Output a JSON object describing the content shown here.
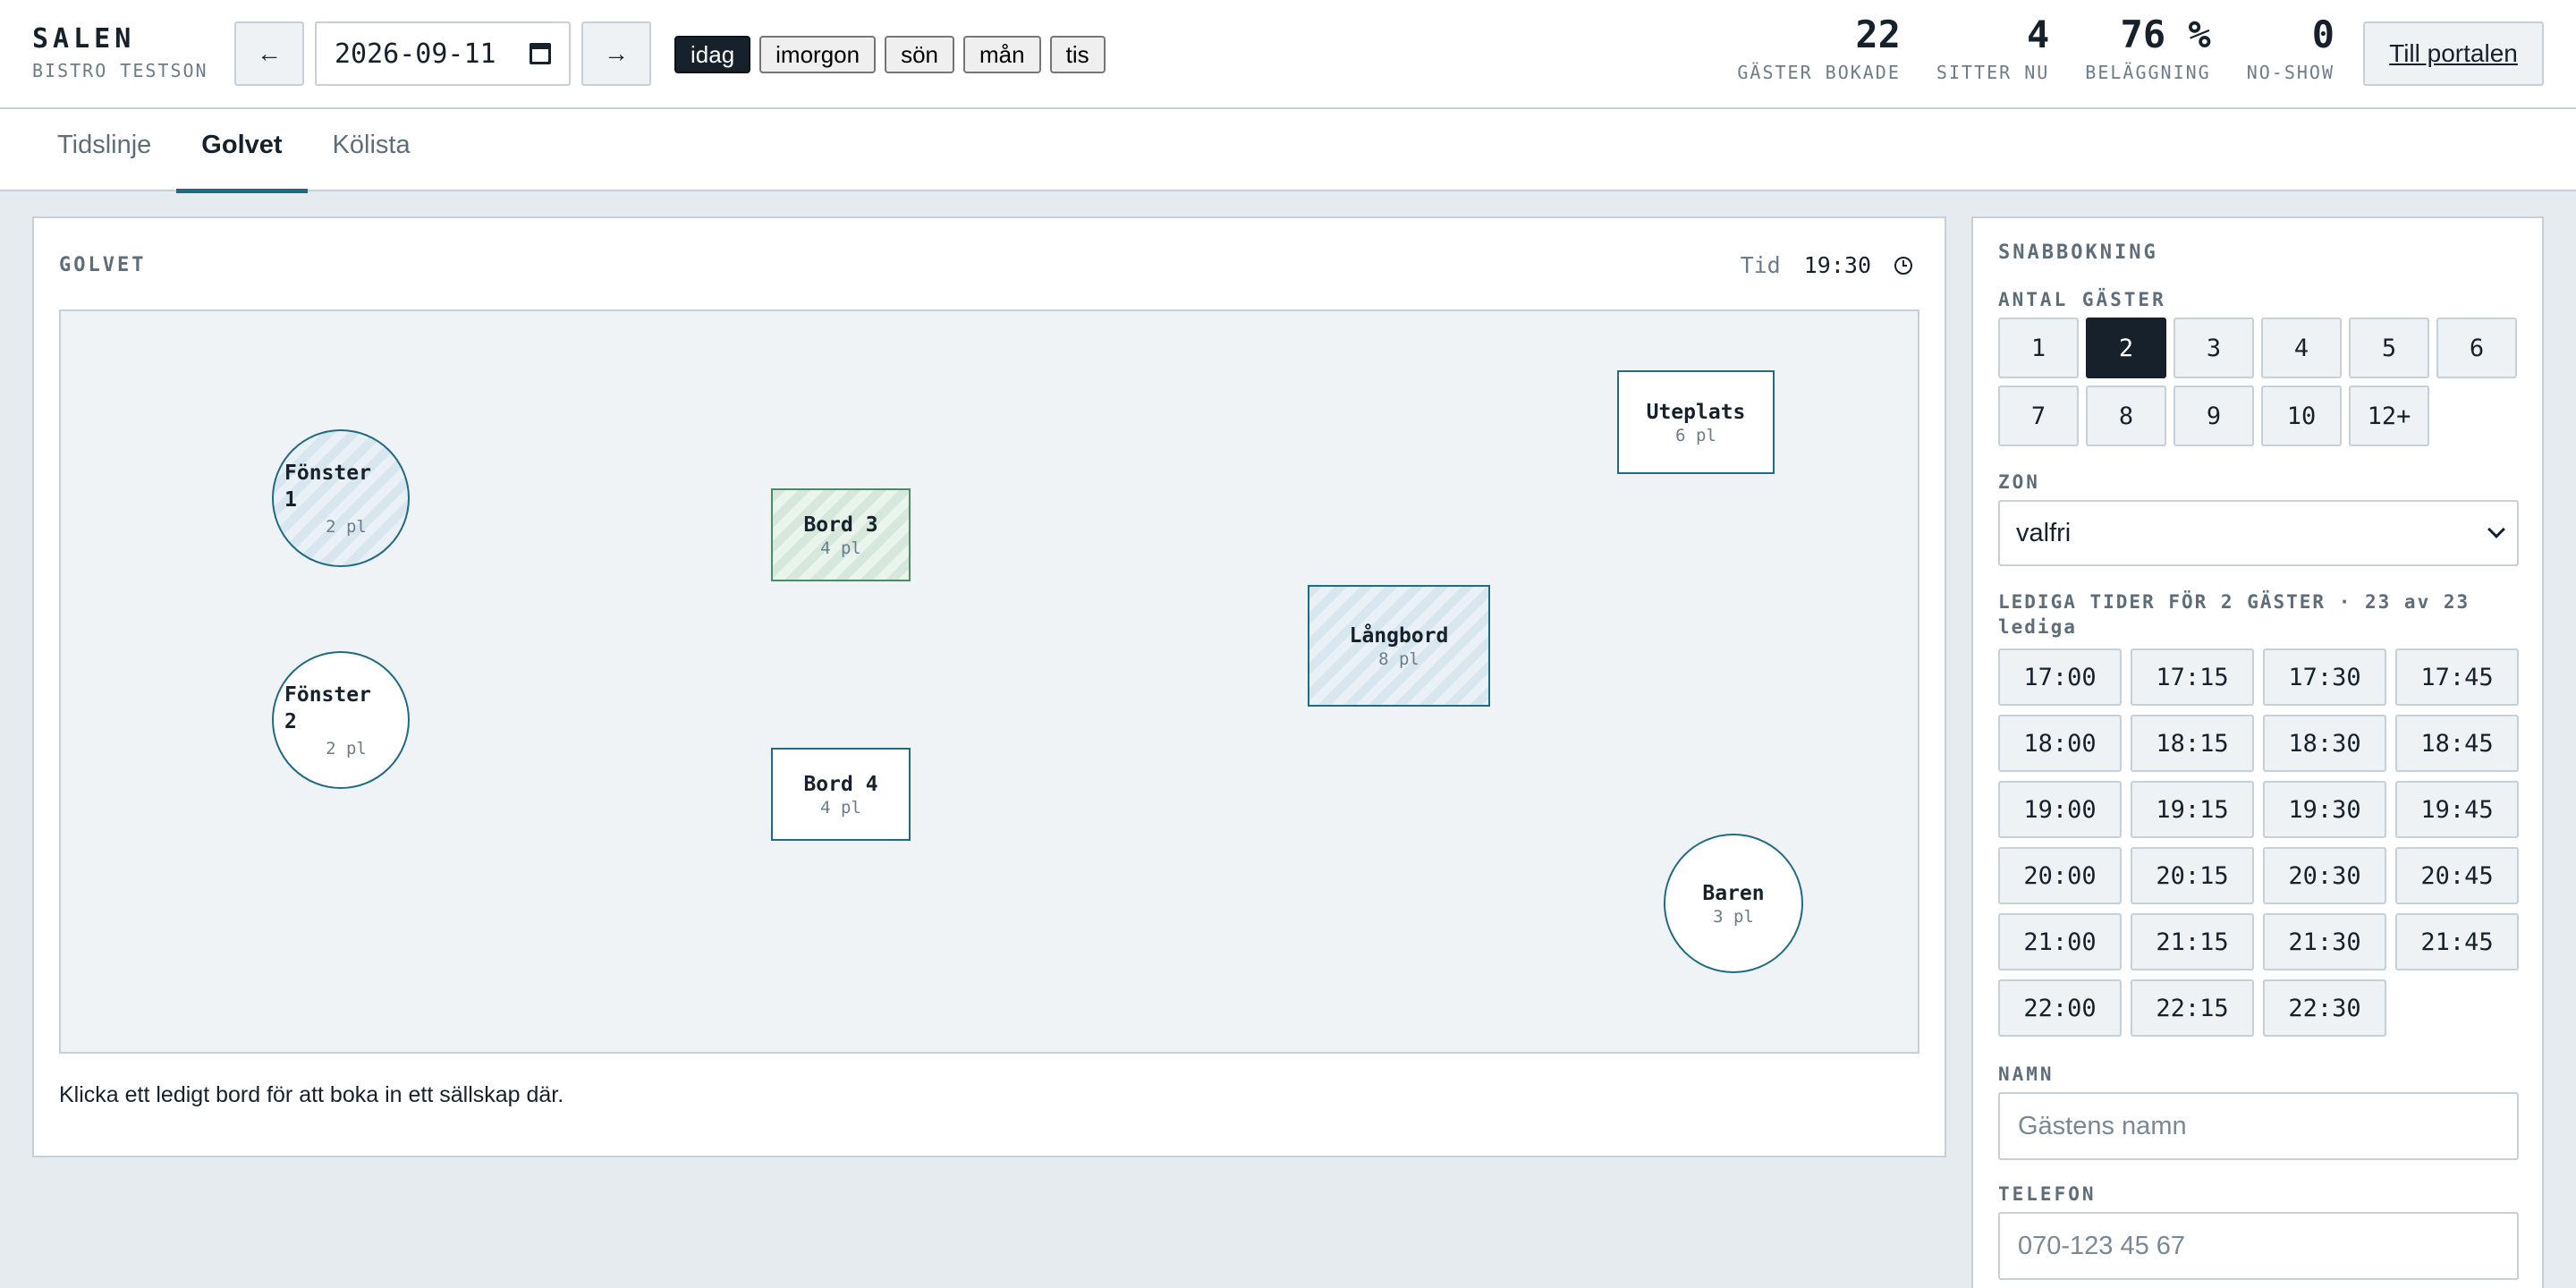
{
  "brand": {
    "title": "SALEN",
    "subtitle": "BISTRO TESTSON"
  },
  "date": {
    "value": "2026-09-11",
    "prev_icon": "arrow-left-icon",
    "next_icon": "arrow-right-icon"
  },
  "quick_days": [
    {
      "label": "idag",
      "active": true
    },
    {
      "label": "imorgon",
      "active": false
    },
    {
      "label": "sön",
      "active": false
    },
    {
      "label": "mån",
      "active": false
    },
    {
      "label": "tis",
      "active": false
    }
  ],
  "stats": [
    {
      "value": "22",
      "label": "GÄSTER BOKADE"
    },
    {
      "value": "4",
      "label": "SITTER NU"
    },
    {
      "value": "76 %",
      "label": "BELÄGGNING"
    },
    {
      "value": "0",
      "label": "NO-SHOW"
    }
  ],
  "portal_label": "Till portalen",
  "tabs": [
    {
      "label": "Tidslinje",
      "active": false
    },
    {
      "label": "Golvet",
      "active": true
    },
    {
      "label": "Kölista",
      "active": false
    }
  ],
  "floor": {
    "heading": "GOLVET",
    "time_label": "Tid",
    "time_value": "19:30",
    "hint": "Klicka ett ledigt bord för att boka in ett sällskap där.",
    "tables": [
      {
        "name": "Fönster 1",
        "name_lines": [
          "Fönster",
          "1"
        ],
        "capacity": "2 pl",
        "status": "reserved"
      },
      {
        "name": "Fönster 2",
        "name_lines": [
          "Fönster",
          "2"
        ],
        "capacity": "2 pl",
        "status": "free"
      },
      {
        "name": "Bord 3",
        "capacity": "4 pl",
        "status": "seated"
      },
      {
        "name": "Bord 4",
        "capacity": "4 pl",
        "status": "free"
      },
      {
        "name": "Långbord",
        "capacity": "8 pl",
        "status": "reserved"
      },
      {
        "name": "Uteplats",
        "capacity": "6 pl",
        "status": "free"
      },
      {
        "name": "Baren",
        "capacity": "3 pl",
        "status": "free"
      }
    ]
  },
  "booking": {
    "title": "SNABBOKNING",
    "guests_label": "ANTAL GÄSTER",
    "guest_options": [
      "1",
      "2",
      "3",
      "4",
      "5",
      "6",
      "7",
      "8",
      "9",
      "10",
      "12+"
    ],
    "guest_selected": "2",
    "zone_label": "ZON",
    "zone_value": "valfri",
    "slots_title": "LEDIGA TIDER FÖR 2 GÄSTER · 23 av 23 lediga",
    "slots": [
      "17:00",
      "17:15",
      "17:30",
      "17:45",
      "18:00",
      "18:15",
      "18:30",
      "18:45",
      "19:00",
      "19:15",
      "19:30",
      "19:45",
      "20:00",
      "20:15",
      "20:30",
      "20:45",
      "21:00",
      "21:15",
      "21:30",
      "21:45",
      "22:00",
      "22:15",
      "22:30"
    ],
    "name_label": "NAMN",
    "name_placeholder": "Gästens namn",
    "phone_label": "TELEFON",
    "phone_placeholder": "070-123 45 67"
  },
  "colors": {
    "accent": "#1f6b83",
    "dark": "#16212c",
    "seated": "#4b8b66"
  }
}
